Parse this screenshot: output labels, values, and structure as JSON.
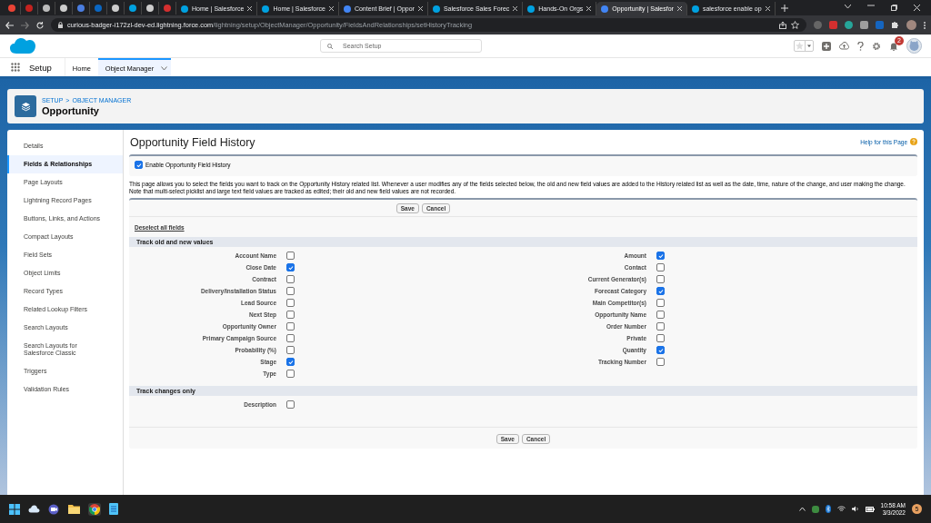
{
  "browser": {
    "tabs": [
      {
        "kind": "icon",
        "selected": false
      },
      {
        "kind": "icon",
        "selected": false
      },
      {
        "kind": "icon",
        "selected": false
      },
      {
        "kind": "icon",
        "selected": false
      },
      {
        "kind": "icon",
        "selected": false
      },
      {
        "kind": "icon",
        "selected": false
      },
      {
        "kind": "icon",
        "selected": false
      },
      {
        "kind": "icon",
        "selected": false
      },
      {
        "kind": "icon",
        "selected": false
      },
      {
        "kind": "icon",
        "selected": false
      },
      {
        "kind": "page",
        "label": "Home | Salesforce",
        "selected": false
      },
      {
        "kind": "page",
        "label": "Home | Salesforce",
        "selected": false
      },
      {
        "kind": "page",
        "label": "Content Brief | Oppor",
        "selected": false
      },
      {
        "kind": "page",
        "label": "Salesforce Sales Forec",
        "selected": false
      },
      {
        "kind": "page",
        "label": "Hands-On Orgs",
        "selected": false
      },
      {
        "kind": "page",
        "label": "Opportunity | Salesfor",
        "selected": true
      },
      {
        "kind": "page",
        "label": "salesforce enable op",
        "selected": false
      }
    ],
    "url_host": "curious-badger-i172zl-dev-ed.lightning.force.com",
    "url_path": "/lightning/setup/ObjectManager/Opportunity/FieldsAndRelationships/setHistoryTracking"
  },
  "header": {
    "search_placeholder": "Search Setup",
    "notification_count": "2"
  },
  "nav": {
    "app": "Setup",
    "tabs": [
      {
        "label": "Home",
        "selected": false
      },
      {
        "label": "Object Manager",
        "selected": true
      }
    ]
  },
  "object_header": {
    "breadcrumb": [
      "SETUP",
      "OBJECT MANAGER"
    ],
    "separator": ">",
    "title": "Opportunity"
  },
  "sidebar": {
    "items": [
      {
        "label": "Details",
        "selected": false
      },
      {
        "label": "Fields & Relationships",
        "selected": true
      },
      {
        "label": "Page Layouts",
        "selected": false
      },
      {
        "label": "Lightning Record Pages",
        "selected": false
      },
      {
        "label": "Buttons, Links, and Actions",
        "selected": false
      },
      {
        "label": "Compact Layouts",
        "selected": false
      },
      {
        "label": "Field Sets",
        "selected": false
      },
      {
        "label": "Object Limits",
        "selected": false
      },
      {
        "label": "Record Types",
        "selected": false
      },
      {
        "label": "Related Lookup Filters",
        "selected": false
      },
      {
        "label": "Search Layouts",
        "selected": false
      },
      {
        "label": "Search Layouts for Salesforce Classic",
        "selected": false
      },
      {
        "label": "Triggers",
        "selected": false
      },
      {
        "label": "Validation Rules",
        "selected": false
      }
    ]
  },
  "main": {
    "title": "Opportunity Field History",
    "help_link": "Help for this Page",
    "enable": {
      "label": "Enable Opportunity Field History",
      "checked": true
    },
    "description": "This page allows you to select the fields you want to track on the Opportunity History related list. Whenever a user modifies any of the fields selected below, the old and new field values are added to the History related list as well as the date, time, nature of the change, and user making the change. Note that multi-select picklist and large text field values are tracked as edited; their old and new field values are not recorded.",
    "top_buttons": [
      "Save",
      "Cancel"
    ],
    "deselect_link": "Deselect all fields",
    "sections": [
      {
        "title": "Track old and new values",
        "columns": [
          {
            "fields": [
              {
                "label": "Account Name",
                "checked": false
              },
              {
                "label": "Close Date",
                "checked": true
              },
              {
                "label": "Contract",
                "checked": false
              },
              {
                "label": "Delivery/Installation Status",
                "checked": false
              },
              {
                "label": "Lead Source",
                "checked": false
              },
              {
                "label": "Next Step",
                "checked": false
              },
              {
                "label": "Opportunity Owner",
                "checked": false
              },
              {
                "label": "Primary Campaign Source",
                "checked": false
              },
              {
                "label": "Probability (%)",
                "checked": false
              },
              {
                "label": "Stage",
                "checked": true
              },
              {
                "label": "Type",
                "checked": false
              }
            ]
          },
          {
            "fields": [
              {
                "label": "Amount",
                "checked": true
              },
              {
                "label": "Contact",
                "checked": false
              },
              {
                "label": "Current Generator(s)",
                "checked": false
              },
              {
                "label": "Forecast Category",
                "checked": true
              },
              {
                "label": "Main Competitor(s)",
                "checked": false
              },
              {
                "label": "Opportunity Name",
                "checked": false
              },
              {
                "label": "Order Number",
                "checked": false
              },
              {
                "label": "Private",
                "checked": false
              },
              {
                "label": "Quantity",
                "checked": true
              },
              {
                "label": "Tracking Number",
                "checked": false
              }
            ]
          }
        ]
      },
      {
        "title": "Track changes only",
        "columns": [
          {
            "fields": [
              {
                "label": "Description",
                "checked": false
              }
            ]
          }
        ]
      }
    ],
    "bottom_buttons": [
      "Save",
      "Cancel"
    ]
  },
  "taskbar": {
    "time": "10:58 AM",
    "date": "3/3/2022",
    "notification_count": "5"
  }
}
